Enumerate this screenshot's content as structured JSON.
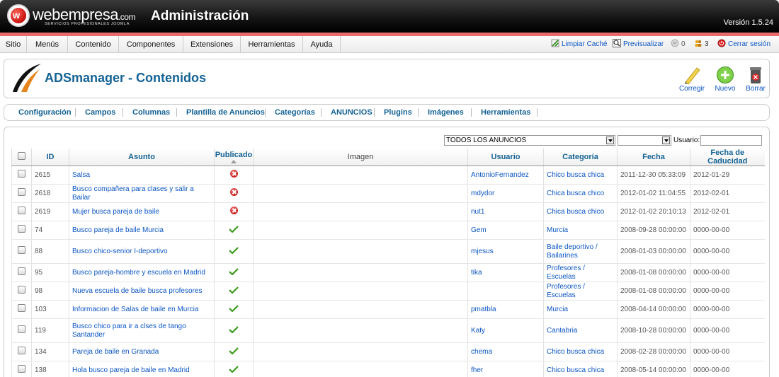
{
  "header": {
    "brand": "webempresa",
    "brand_tld": ".com",
    "brand_tag": "SERVICIOS PROFESIONALES JOOMLA",
    "title": "Administración",
    "version": "Versión 1.5.24"
  },
  "menu": [
    "Sitio",
    "Menús",
    "Contenido",
    "Componentes",
    "Extensiones",
    "Herramientas",
    "Ayuda"
  ],
  "tools": {
    "clear_cache": "Limpiar Caché",
    "preview": "Previsualizar",
    "messages_count": "0",
    "users_count": "3",
    "logout": "Cerrar sesión"
  },
  "page": {
    "title": "ADSmanager - Contenidos"
  },
  "toolbar": {
    "edit": "Corregir",
    "new": "Nuevo",
    "delete": "Borrar"
  },
  "submenu": [
    "Configuración",
    "Campos",
    "Columnas",
    "Plantilla de Anuncios",
    "Categorías",
    "ANUNCIOS",
    "Plugins",
    "Imágenes",
    "Herramientas"
  ],
  "filters": {
    "ads_filter": "TODOS LOS ANUNCIOS",
    "second_filter": "",
    "user_label": "Usuario:",
    "user_value": ""
  },
  "table": {
    "headers": {
      "id": "ID",
      "subject": "Asunto",
      "published": "Publicado",
      "image": "Imagen",
      "user": "Usuario",
      "category": "Categoría",
      "date": "Fecha",
      "expiry": "Fecha de Caducidad"
    },
    "rows": [
      {
        "id": "2615",
        "subject": "Salsa",
        "published": false,
        "user": "AntonioFernandez",
        "category": "Chico busca chica",
        "date": "2011-12-30 05:33:09",
        "expiry": "2012-01-29"
      },
      {
        "id": "2618",
        "subject": "Busco compañera para clases y salir a Bailar",
        "published": false,
        "user": "mdydor",
        "category": "Chica busca chico",
        "date": "2012-01-02 11:04:55",
        "expiry": "2012-02-01"
      },
      {
        "id": "2619",
        "subject": "Mujer busca pareja de baile",
        "published": false,
        "user": "nut1",
        "category": "Chica busca chico",
        "date": "2012-01-02 20:10:13",
        "expiry": "2012-02-01"
      },
      {
        "id": "74",
        "subject": "Busco pareja de baile Murcia",
        "published": true,
        "user": "Gem",
        "category": "Murcia",
        "date": "2008-09-28 00:00:00",
        "expiry": "0000-00-00"
      },
      {
        "id": "88",
        "subject": "Busco chico-senior I-deportivo",
        "published": true,
        "user": "mjesus",
        "category": "Baile deportivo / Bailarines",
        "date": "2008-01-03 00:00:00",
        "expiry": "0000-00-00"
      },
      {
        "id": "95",
        "subject": "Busco pareja-hombre y escuela en Madrid",
        "published": true,
        "user": "tika",
        "category": "Profesores / Escuelas",
        "date": "2008-01-08 00:00:00",
        "expiry": "0000-00-00"
      },
      {
        "id": "98",
        "subject": "Nueva escuela de baile busca profesores",
        "published": true,
        "user": "",
        "category": "Profesores / Escuelas",
        "date": "2008-01-08 00:00:00",
        "expiry": "0000-00-00"
      },
      {
        "id": "103",
        "subject": "Informacion de Salas de baile en Murcia",
        "published": true,
        "user": "pmatbla",
        "category": "Murcia",
        "date": "2008-04-14 00:00:00",
        "expiry": "0000-00-00"
      },
      {
        "id": "119",
        "subject": "Busco chico para ir a clses de tango Santander",
        "published": true,
        "user": "Katy",
        "category": "Cantabria",
        "date": "2008-10-28 00:00:00",
        "expiry": "0000-00-00"
      },
      {
        "id": "134",
        "subject": "Pareja de baile en Granada",
        "published": true,
        "user": "chema",
        "category": "Chico busca chica",
        "date": "2008-02-28 00:00:00",
        "expiry": "0000-00-00"
      },
      {
        "id": "138",
        "subject": "Hola busco pareja de baile en Madrid",
        "published": true,
        "user": "fher",
        "category": "Chico busca chica",
        "date": "2008-05-14 00:00:00",
        "expiry": "0000-00-00"
      }
    ]
  },
  "colors": {
    "header_bg": "#000000",
    "accent_red": "#e86a6a",
    "link_blue": "#0b55c4",
    "title_blue": "#146295"
  },
  "icons": {
    "unpublished": "red-x-circle-icon",
    "published": "green-check-icon"
  }
}
